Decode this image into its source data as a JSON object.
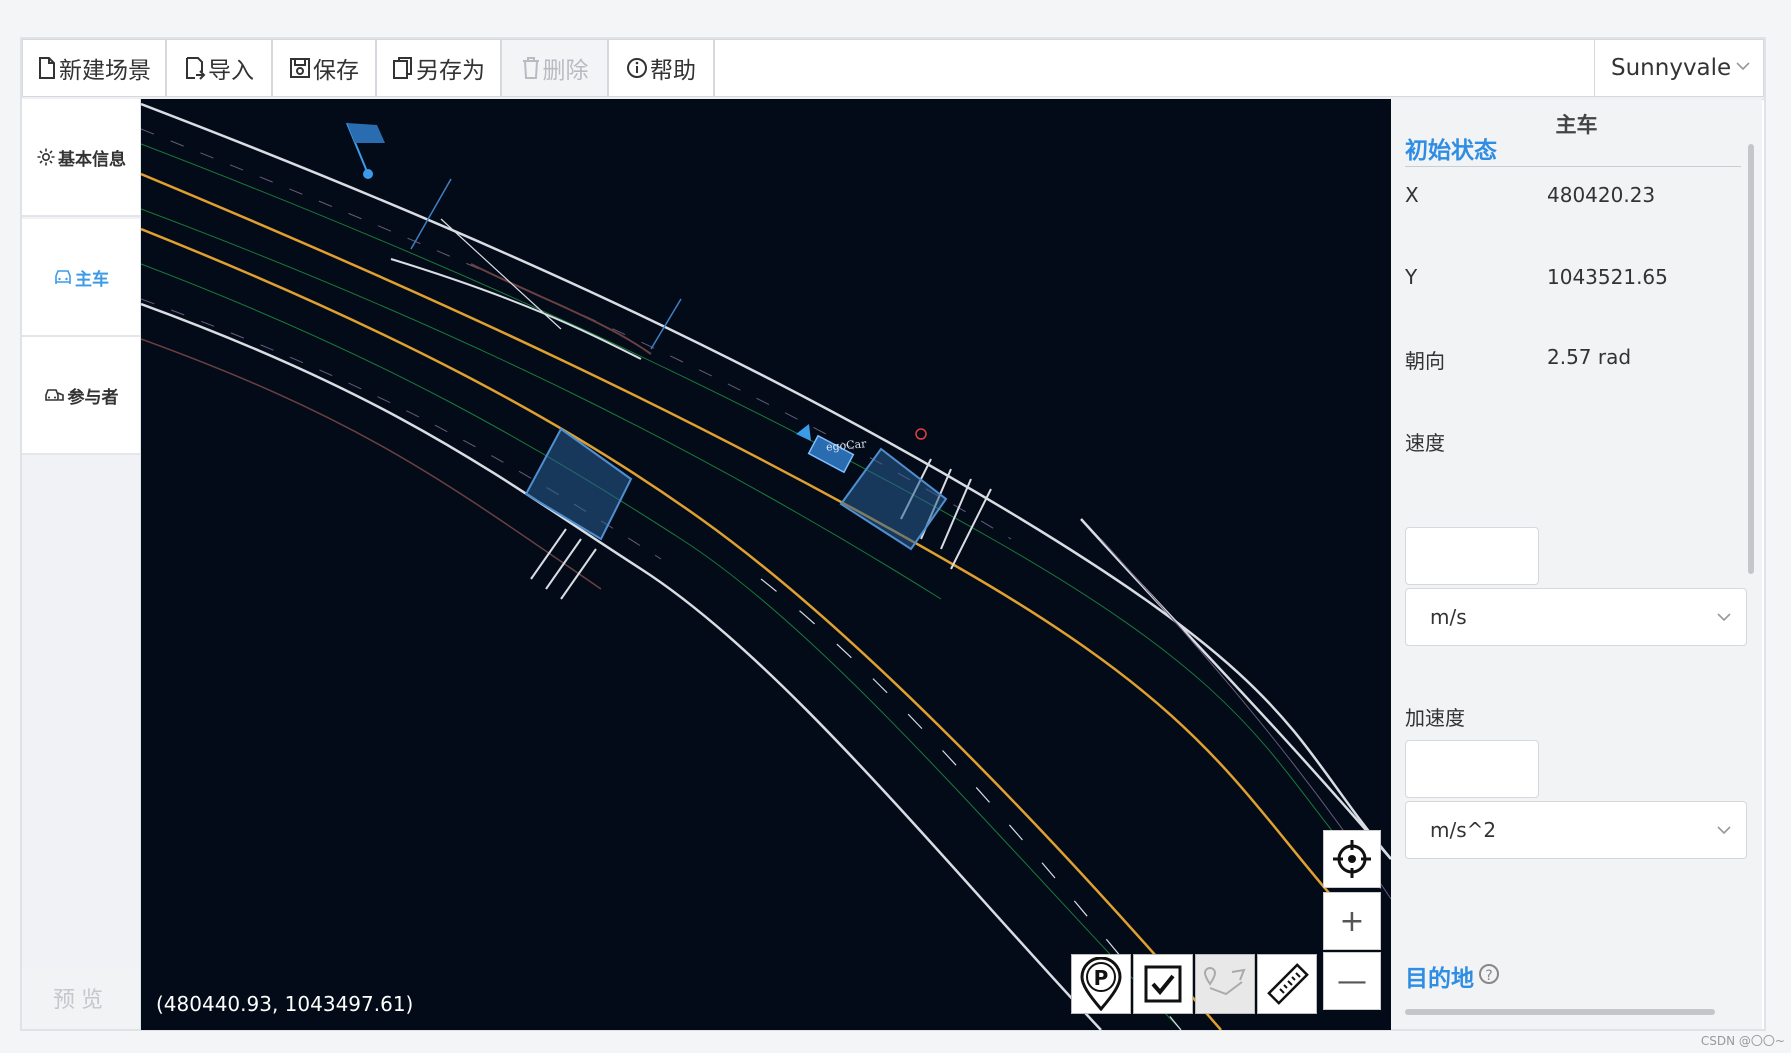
{
  "toolbar": {
    "new_scene": "新建场景",
    "import": "导入",
    "save": "保存",
    "save_as": "另存为",
    "delete": "删除",
    "help": "帮助",
    "city": "Sunnyvale"
  },
  "sidebar": {
    "basic_info": "基本信息",
    "ego_car": "主车",
    "participants": "参与者",
    "preview": "预览"
  },
  "map": {
    "coordinate_readout": "(480440.93, 1043497.61)",
    "ego_label": "egoCar",
    "zoom_in": "+",
    "zoom_out": "—"
  },
  "panel": {
    "title": "主车",
    "initial_state": "初始状态",
    "x_label": "X",
    "x_value": "480420.23",
    "y_label": "Y",
    "y_value": "1043521.65",
    "heading_label": "朝向",
    "heading_value": "2.57 rad",
    "speed_label": "速度",
    "speed_value": "",
    "speed_unit": "m/s",
    "accel_label": "加速度",
    "accel_value": "",
    "accel_unit": "m/s^2",
    "destination": "目的地",
    "help_mark": "?"
  },
  "watermark": "CSDN @〇〇~",
  "colors": {
    "accent": "#2f8ee3",
    "map_bg": "#020b17",
    "lane_yellow": "#e0a030",
    "lane_white": "#d9dde3",
    "junction_blue": "#3f7fc4"
  }
}
